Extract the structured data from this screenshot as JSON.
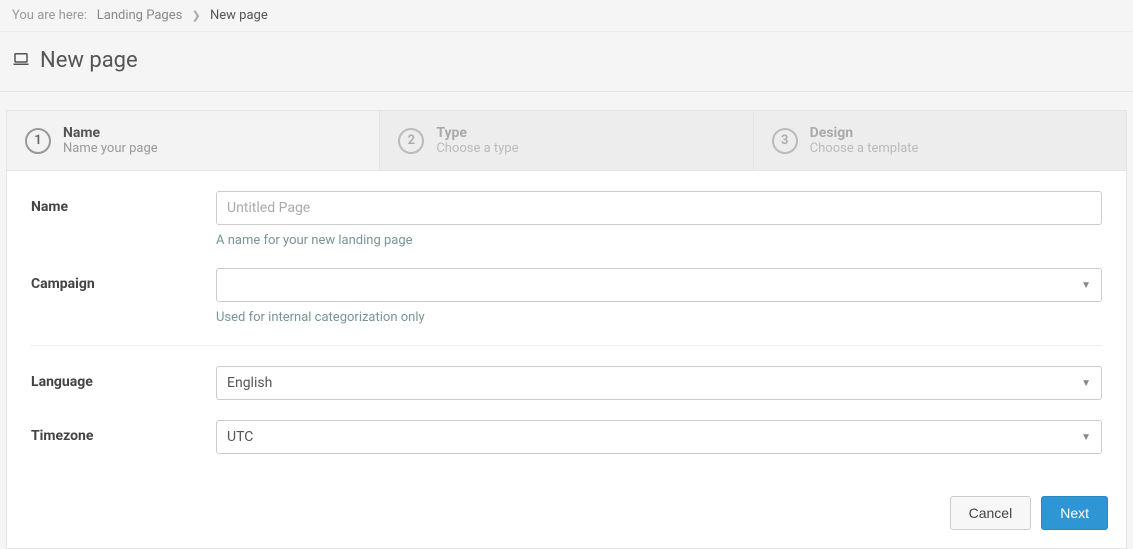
{
  "breadcrumb": {
    "prefix": "You are here:",
    "items": [
      "Landing Pages",
      "New page"
    ]
  },
  "page_title": "New page",
  "steps": [
    {
      "num": "1",
      "title": "Name",
      "sub": "Name your page"
    },
    {
      "num": "2",
      "title": "Type",
      "sub": "Choose a type"
    },
    {
      "num": "3",
      "title": "Design",
      "sub": "Choose a template"
    }
  ],
  "form": {
    "name": {
      "label": "Name",
      "placeholder": "Untitled Page",
      "help": "A name for your new landing page"
    },
    "campaign": {
      "label": "Campaign",
      "value": "",
      "help": "Used for internal categorization only"
    },
    "language": {
      "label": "Language",
      "value": "English"
    },
    "timezone": {
      "label": "Timezone",
      "value": "UTC"
    }
  },
  "buttons": {
    "cancel": "Cancel",
    "next": "Next"
  }
}
